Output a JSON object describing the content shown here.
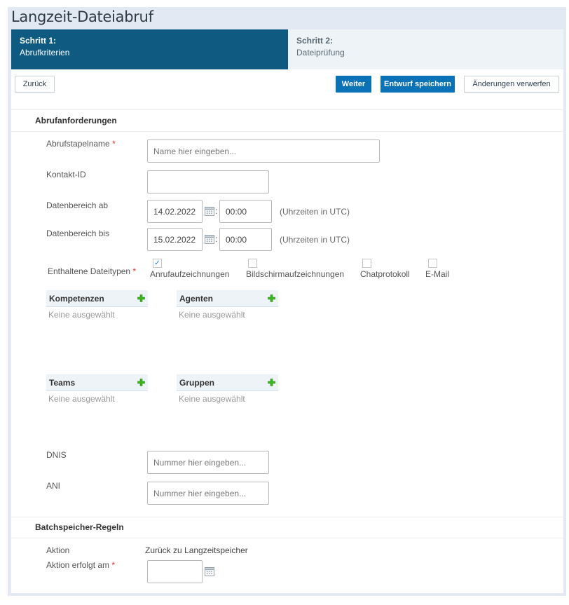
{
  "page": {
    "title": "Langzeit-Dateiabruf"
  },
  "steps": [
    {
      "number": "Schritt 1:",
      "name": "Abrufkriterien",
      "active": true
    },
    {
      "number": "Schritt 2:",
      "name": "Dateiprüfung",
      "active": false
    }
  ],
  "toolbar": {
    "back_label": "Zurück",
    "next_label": "Weiter",
    "save_draft_label": "Entwurf speichern",
    "discard_label": "Änderungen verwerfen"
  },
  "colors": {
    "active_step": "#0e5a80",
    "primary_button": "#0a72b6",
    "required": "#e03030",
    "add_icon": "#3cb521"
  },
  "requirements": {
    "section_title": "Abrufanforderungen",
    "batch_name": {
      "label": "Abrufstapelname",
      "required_mark": "*",
      "value": "",
      "placeholder": "Name hier eingeben..."
    },
    "contact_id": {
      "label": "Kontakt-ID",
      "value": ""
    },
    "date_from": {
      "label": "Datenbereich ab",
      "date": "14.02.2022",
      "separator": ":",
      "time": "00:00",
      "note": "(Uhrzeiten in UTC)"
    },
    "date_to": {
      "label": "Datenbereich bis",
      "date": "15.02.2022",
      "separator": ":",
      "time": "00:00",
      "note": "(Uhrzeiten in UTC)"
    },
    "file_types": {
      "label": "Enthaltene Dateitypen",
      "required_mark": "*",
      "options": [
        {
          "label": "Anrufaufzeichnungen",
          "checked": true,
          "check_glyph": "✓"
        },
        {
          "label": "Bildschirmaufzeichnungen",
          "checked": false,
          "check_glyph": ""
        },
        {
          "label": "Chatprotokoll",
          "checked": false,
          "check_glyph": ""
        },
        {
          "label": "E-Mail",
          "checked": false,
          "check_glyph": ""
        }
      ]
    },
    "pickers": [
      {
        "title": "Kompetenzen",
        "empty_text": "Keine ausgewählt",
        "icon": "add-icon"
      },
      {
        "title": "Agenten",
        "empty_text": "Keine ausgewählt",
        "icon": "add-icon"
      },
      {
        "title": "Teams",
        "empty_text": "Keine ausgewählt",
        "icon": "add-icon"
      },
      {
        "title": "Gruppen",
        "empty_text": "Keine ausgewählt",
        "icon": "add-icon"
      }
    ],
    "dnis": {
      "label": "DNIS",
      "value": "",
      "placeholder": "Nummer hier eingeben..."
    },
    "ani": {
      "label": "ANI",
      "value": "",
      "placeholder": "Nummer hier eingeben..."
    }
  },
  "storage_rules": {
    "section_title": "Batchspeicher-Regeln",
    "action": {
      "label": "Aktion",
      "value": "Zurück zu Langzeitspeicher"
    },
    "action_date": {
      "label": "Aktion erfolgt am",
      "required_mark": "*",
      "value": ""
    }
  }
}
